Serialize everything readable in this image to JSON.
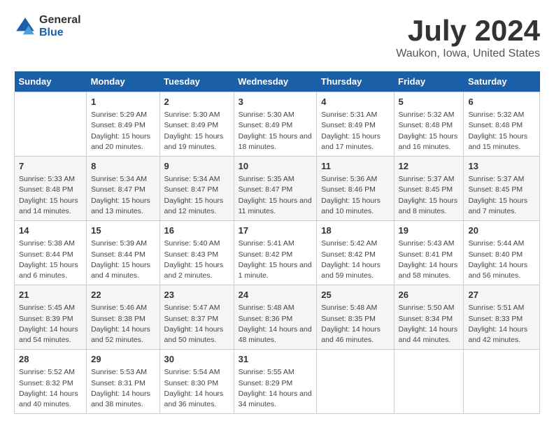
{
  "logo": {
    "general": "General",
    "blue": "Blue"
  },
  "title": "July 2024",
  "subtitle": "Waukon, Iowa, United States",
  "days_of_week": [
    "Sunday",
    "Monday",
    "Tuesday",
    "Wednesday",
    "Thursday",
    "Friday",
    "Saturday"
  ],
  "weeks": [
    [
      {
        "day": "",
        "info": ""
      },
      {
        "day": "1",
        "info": "Sunrise: 5:29 AM\nSunset: 8:49 PM\nDaylight: 15 hours and 20 minutes."
      },
      {
        "day": "2",
        "info": "Sunrise: 5:30 AM\nSunset: 8:49 PM\nDaylight: 15 hours and 19 minutes."
      },
      {
        "day": "3",
        "info": "Sunrise: 5:30 AM\nSunset: 8:49 PM\nDaylight: 15 hours and 18 minutes."
      },
      {
        "day": "4",
        "info": "Sunrise: 5:31 AM\nSunset: 8:49 PM\nDaylight: 15 hours and 17 minutes."
      },
      {
        "day": "5",
        "info": "Sunrise: 5:32 AM\nSunset: 8:48 PM\nDaylight: 15 hours and 16 minutes."
      },
      {
        "day": "6",
        "info": "Sunrise: 5:32 AM\nSunset: 8:48 PM\nDaylight: 15 hours and 15 minutes."
      }
    ],
    [
      {
        "day": "7",
        "info": "Sunrise: 5:33 AM\nSunset: 8:48 PM\nDaylight: 15 hours and 14 minutes."
      },
      {
        "day": "8",
        "info": "Sunrise: 5:34 AM\nSunset: 8:47 PM\nDaylight: 15 hours and 13 minutes."
      },
      {
        "day": "9",
        "info": "Sunrise: 5:34 AM\nSunset: 8:47 PM\nDaylight: 15 hours and 12 minutes."
      },
      {
        "day": "10",
        "info": "Sunrise: 5:35 AM\nSunset: 8:47 PM\nDaylight: 15 hours and 11 minutes."
      },
      {
        "day": "11",
        "info": "Sunrise: 5:36 AM\nSunset: 8:46 PM\nDaylight: 15 hours and 10 minutes."
      },
      {
        "day": "12",
        "info": "Sunrise: 5:37 AM\nSunset: 8:45 PM\nDaylight: 15 hours and 8 minutes."
      },
      {
        "day": "13",
        "info": "Sunrise: 5:37 AM\nSunset: 8:45 PM\nDaylight: 15 hours and 7 minutes."
      }
    ],
    [
      {
        "day": "14",
        "info": "Sunrise: 5:38 AM\nSunset: 8:44 PM\nDaylight: 15 hours and 6 minutes."
      },
      {
        "day": "15",
        "info": "Sunrise: 5:39 AM\nSunset: 8:44 PM\nDaylight: 15 hours and 4 minutes."
      },
      {
        "day": "16",
        "info": "Sunrise: 5:40 AM\nSunset: 8:43 PM\nDaylight: 15 hours and 2 minutes."
      },
      {
        "day": "17",
        "info": "Sunrise: 5:41 AM\nSunset: 8:42 PM\nDaylight: 15 hours and 1 minute."
      },
      {
        "day": "18",
        "info": "Sunrise: 5:42 AM\nSunset: 8:42 PM\nDaylight: 14 hours and 59 minutes."
      },
      {
        "day": "19",
        "info": "Sunrise: 5:43 AM\nSunset: 8:41 PM\nDaylight: 14 hours and 58 minutes."
      },
      {
        "day": "20",
        "info": "Sunrise: 5:44 AM\nSunset: 8:40 PM\nDaylight: 14 hours and 56 minutes."
      }
    ],
    [
      {
        "day": "21",
        "info": "Sunrise: 5:45 AM\nSunset: 8:39 PM\nDaylight: 14 hours and 54 minutes."
      },
      {
        "day": "22",
        "info": "Sunrise: 5:46 AM\nSunset: 8:38 PM\nDaylight: 14 hours and 52 minutes."
      },
      {
        "day": "23",
        "info": "Sunrise: 5:47 AM\nSunset: 8:37 PM\nDaylight: 14 hours and 50 minutes."
      },
      {
        "day": "24",
        "info": "Sunrise: 5:48 AM\nSunset: 8:36 PM\nDaylight: 14 hours and 48 minutes."
      },
      {
        "day": "25",
        "info": "Sunrise: 5:48 AM\nSunset: 8:35 PM\nDaylight: 14 hours and 46 minutes."
      },
      {
        "day": "26",
        "info": "Sunrise: 5:50 AM\nSunset: 8:34 PM\nDaylight: 14 hours and 44 minutes."
      },
      {
        "day": "27",
        "info": "Sunrise: 5:51 AM\nSunset: 8:33 PM\nDaylight: 14 hours and 42 minutes."
      }
    ],
    [
      {
        "day": "28",
        "info": "Sunrise: 5:52 AM\nSunset: 8:32 PM\nDaylight: 14 hours and 40 minutes."
      },
      {
        "day": "29",
        "info": "Sunrise: 5:53 AM\nSunset: 8:31 PM\nDaylight: 14 hours and 38 minutes."
      },
      {
        "day": "30",
        "info": "Sunrise: 5:54 AM\nSunset: 8:30 PM\nDaylight: 14 hours and 36 minutes."
      },
      {
        "day": "31",
        "info": "Sunrise: 5:55 AM\nSunset: 8:29 PM\nDaylight: 14 hours and 34 minutes."
      },
      {
        "day": "",
        "info": ""
      },
      {
        "day": "",
        "info": ""
      },
      {
        "day": "",
        "info": ""
      }
    ]
  ]
}
